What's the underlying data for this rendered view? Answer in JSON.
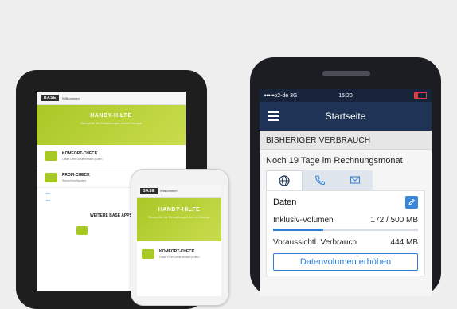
{
  "colors": {
    "brand_green": "#a8c826",
    "navy": "#1e3355",
    "accent_blue": "#2f7fd6",
    "background": "#eeeeee"
  },
  "tablet": {
    "logo": "BASE",
    "header_text": "Willkommen",
    "hero_title": "HANDY-HILFE",
    "hero_sub": "Überprüfe die Einstellungen deines Handys",
    "rows": [
      {
        "title": "KOMFORT-CHECK",
        "sub": "Lasse Dein Gerät einfach prüfen"
      },
      {
        "title": "PROFI-CHECK",
        "sub": "Schnell konfiguriert"
      }
    ],
    "links": [
      "Link",
      "Link"
    ],
    "apps_title": "WEITERE BASE APPS",
    "app_icons": [
      "app-icon",
      "app-icon"
    ]
  },
  "phone_small": {
    "logo": "BASE",
    "header_text": "Willkommen",
    "hero_title": "HANDY-HILFE",
    "hero_sub": "Überprüfe die Einstellungen deines Handys",
    "row_title": "KOMFORT-CHECK",
    "row_sub": "Lasse Dein Gerät einfach prüfen"
  },
  "phone_big": {
    "status": {
      "carrier": "•••••o2-de  3G",
      "time": "15:20"
    },
    "title": "Startseite",
    "section": "BISHERIGER VERBRAUCH",
    "days": "Noch 19 Tage im Rechnungsmonat",
    "tabs": [
      {
        "icon": "globe-icon",
        "active": true
      },
      {
        "icon": "phone-icon",
        "active": false
      },
      {
        "icon": "mail-icon",
        "active": false
      }
    ],
    "card": {
      "heading": "Daten",
      "volume_label": "Inklusiv-Volumen",
      "volume_value": "172 / 500 MB",
      "volume_fraction": 0.344,
      "forecast_label": "Voraussichtl. Verbrauch",
      "forecast_value": "444 MB",
      "cta": "Datenvolumen erhöhen"
    }
  }
}
